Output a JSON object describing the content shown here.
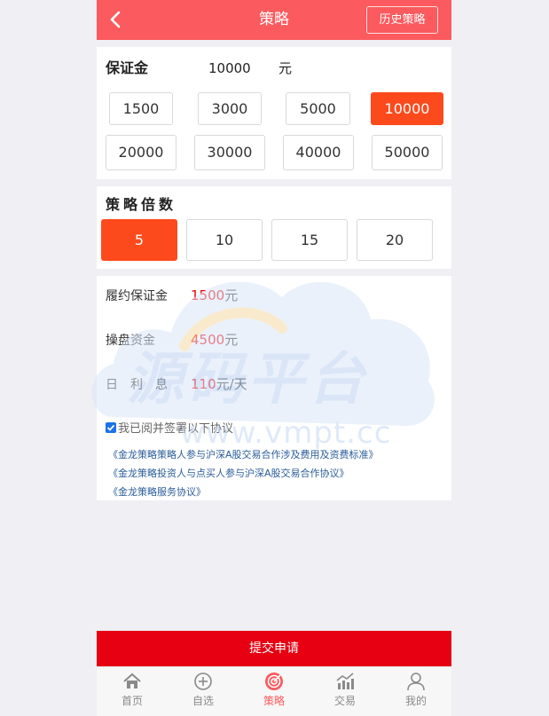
{
  "header": {
    "title": "策略",
    "history_label": "历史策略"
  },
  "deposit": {
    "label": "保证金",
    "value": "10000",
    "unit": "元",
    "options": [
      "1500",
      "3000",
      "5000",
      "10000",
      "20000",
      "30000",
      "40000",
      "50000"
    ],
    "selected": "10000"
  },
  "multiplier": {
    "label": "策略倍数",
    "options": [
      "5",
      "10",
      "15",
      "20"
    ],
    "selected": "5"
  },
  "info": {
    "performance_deposit_label": "履约保证金",
    "performance_deposit_value": "1500",
    "performance_deposit_unit": "元",
    "trading_capital_label": "操盘资金",
    "trading_capital_value": "4500",
    "trading_capital_unit": "元",
    "daily_interest_label": "日　利　息",
    "daily_interest_value": "110",
    "daily_interest_unit": "元/天"
  },
  "agreement": {
    "checked": true,
    "text": "我已阅并签署以下协议",
    "links": [
      "《金龙策略策略人参与沪深A股交易合作涉及费用及资费标准》",
      "《金龙策略投资人与点买人参与沪深A股交易合作协议》",
      "《金龙策略服务协议》"
    ]
  },
  "watermark": {
    "title": "源码平台",
    "url": "www.vmpt.cc"
  },
  "submit_label": "提交申请",
  "tabbar": {
    "items": [
      {
        "label": "首页",
        "icon": "home-icon"
      },
      {
        "label": "自选",
        "icon": "plus-circle-icon"
      },
      {
        "label": "策略",
        "icon": "target-icon"
      },
      {
        "label": "交易",
        "icon": "chart-icon"
      },
      {
        "label": "我的",
        "icon": "user-icon"
      }
    ],
    "active": "策略"
  },
  "colors": {
    "header": "#fb5a5e",
    "selected_option": "#fc4a1c",
    "submit": "#e60012",
    "value_red": "#e00000",
    "link_blue": "#2a5c9a"
  }
}
